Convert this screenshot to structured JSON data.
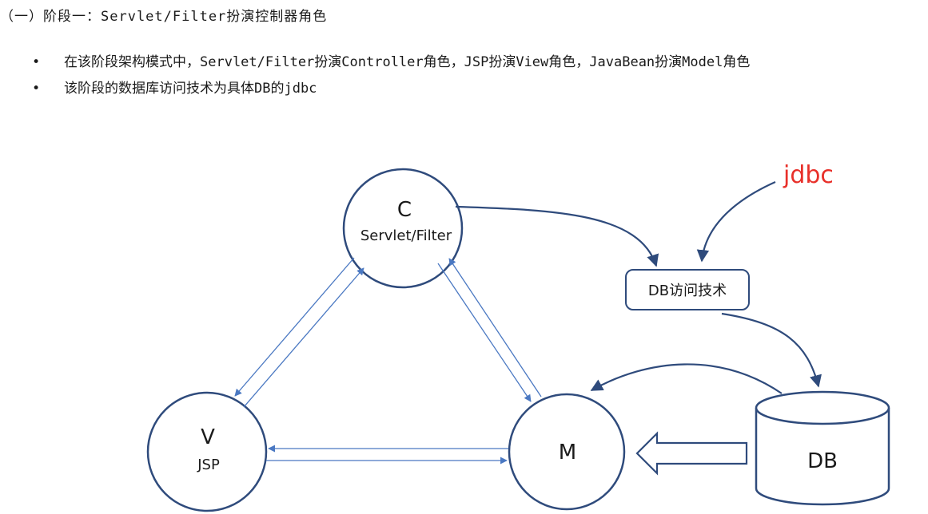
{
  "heading": "（一）阶段一：Servlet/Filter扮演控制器角色",
  "bullets": [
    "在该阶段架构模式中，Servlet/Filter扮演Controller角色，JSP扮演View角色，JavaBean扮演Model角色",
    "该阶段的数据库访问技术为具体DB的jdbc"
  ],
  "diagram": {
    "controller": {
      "letter": "C",
      "label": "Servlet/Filter"
    },
    "view": {
      "letter": "V",
      "label": "JSP"
    },
    "model": {
      "letter": "M"
    },
    "db_access_box": "DB访问技术",
    "db": "DB",
    "jdbc_note": "jdbc"
  },
  "colors": {
    "stroke": "#2f4b7c",
    "arrow": "#4a78c2",
    "note": "#e8302a",
    "text": "#1a1a1a"
  }
}
